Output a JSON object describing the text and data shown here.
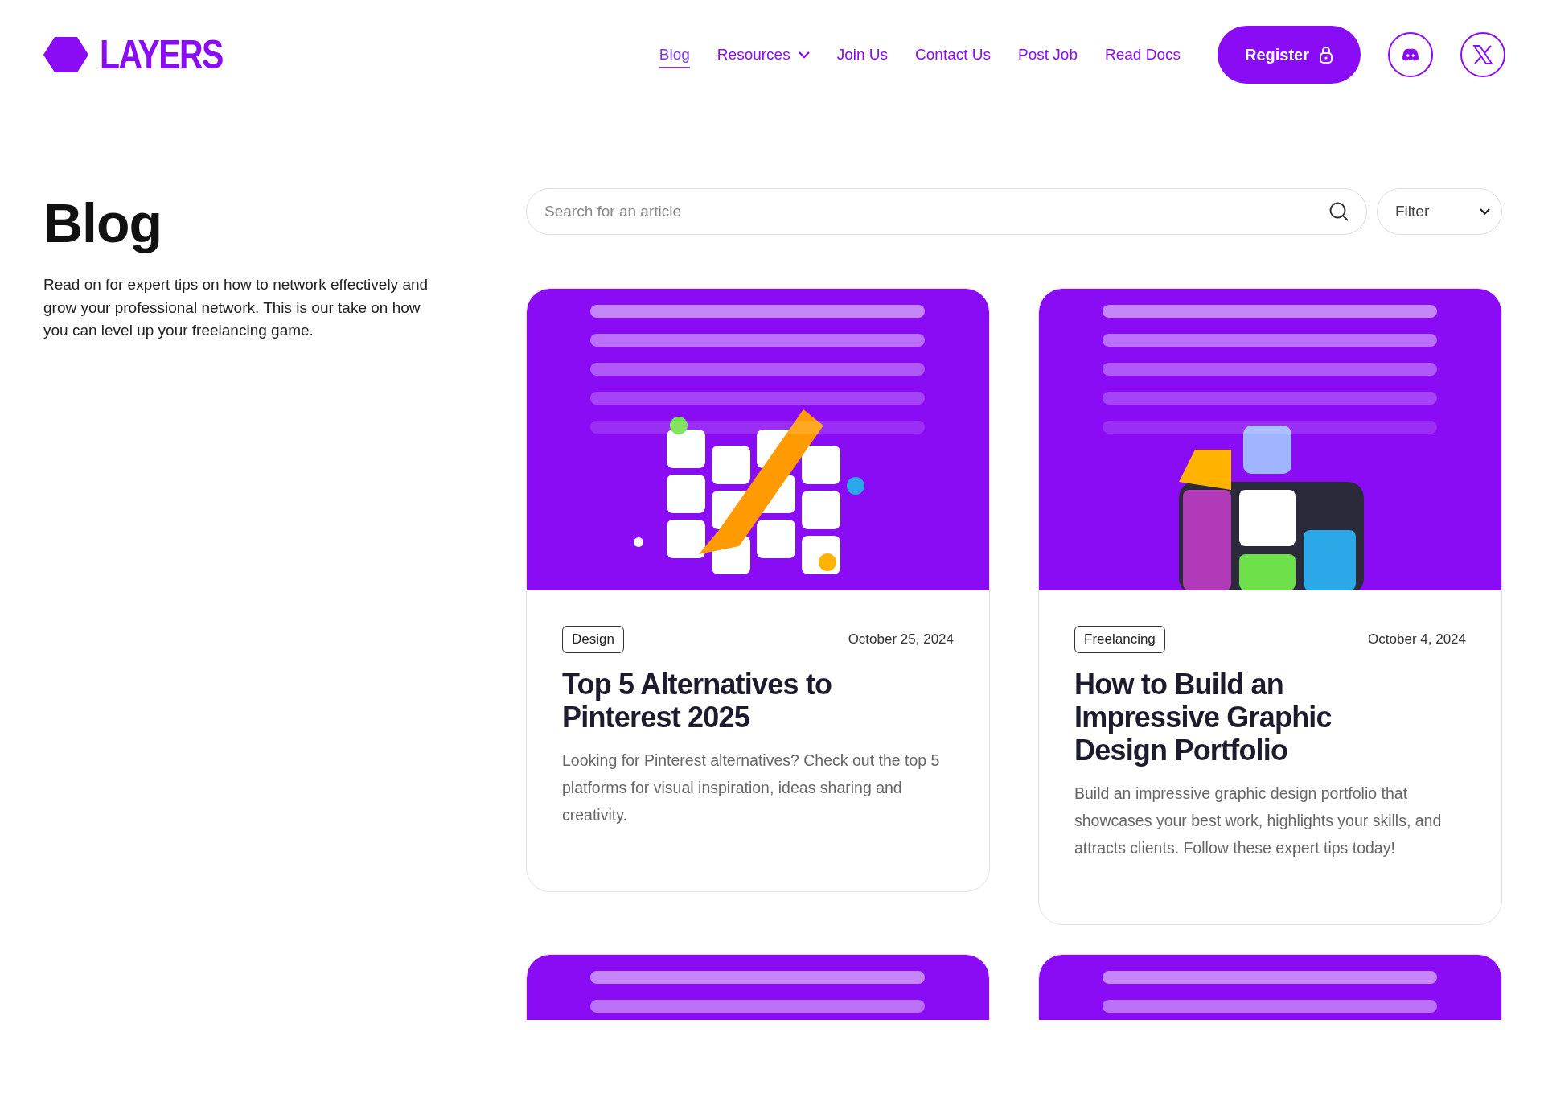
{
  "logo": {
    "text": "LAYERS"
  },
  "nav": {
    "links": [
      {
        "label": "Blog",
        "kind": "link",
        "selected": true
      },
      {
        "label": "Resources",
        "kind": "dropdown",
        "selected": false
      },
      {
        "label": "Join Us",
        "kind": "link",
        "selected": false
      },
      {
        "label": "Contact Us",
        "kind": "link",
        "selected": false
      },
      {
        "label": "Post Job",
        "kind": "link",
        "selected": false
      },
      {
        "label": "Read Docs",
        "kind": "link",
        "selected": false
      }
    ],
    "register": "Register"
  },
  "intro": {
    "title": "Blog",
    "description": "Read on for expert tips on how to network effectively and grow your professional network. This is our take on how you can level up your freelancing game."
  },
  "search": {
    "placeholder": "Search for an article"
  },
  "filter": {
    "value": "Filter"
  },
  "posts": [
    {
      "image": {
        "kind": "picture"
      },
      "tag": "Design",
      "date": "October 25, 2024",
      "title": "Top 5 Alternatives to Pinterest 2025",
      "excerpt": "Looking for Pinterest alternatives? Check out the top 5 platforms for visual inspiration, ideas sharing and creativity."
    },
    {
      "image": {
        "kind": "picture"
      },
      "tag": "Freelancing",
      "date": "October 4, 2024",
      "title": "How to Build an Impressive Graphic Design Portfolio",
      "excerpt": "Build an impressive graphic design portfolio that showcases your best work, highlights your skills, and attracts clients. Follow these expert tips today!"
    },
    {
      "image": {
        "kind": "picture"
      }
    },
    {
      "image": {
        "kind": "picture"
      }
    }
  ]
}
